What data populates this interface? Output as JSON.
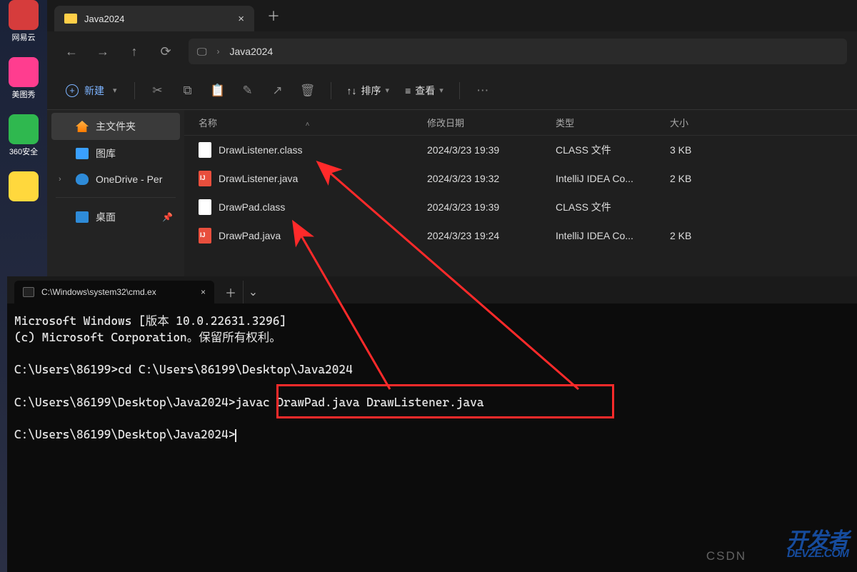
{
  "desktop": {
    "icons": [
      {
        "label": "网易云",
        "color": "#d63c3c"
      },
      {
        "label": "美图秀",
        "color": "#ff3d8f"
      },
      {
        "label": "360安全",
        "color": "#2fb84f"
      },
      {
        "label": "",
        "color": "#ffd83d"
      }
    ]
  },
  "explorer": {
    "tab_title": "Java2024",
    "breadcrumb": "Java2024",
    "new_label": "新建",
    "sort_label": "排序",
    "view_label": "查看",
    "sidebar": {
      "items": [
        {
          "label": "主文件夹",
          "icon": "home",
          "active": true
        },
        {
          "label": "图库",
          "icon": "gallery"
        },
        {
          "label": "OneDrive - Per",
          "icon": "onedrive",
          "chevron": true
        },
        {
          "label": "桌面",
          "icon": "desktop",
          "pin": true
        }
      ]
    },
    "columns": {
      "name": "名称",
      "date": "修改日期",
      "type": "类型",
      "size": "大小"
    },
    "rows": [
      {
        "name": "DrawListener.class",
        "icon": "class",
        "date": "2024/3/23 19:39",
        "type": "CLASS 文件",
        "size": "3 KB"
      },
      {
        "name": "DrawListener.java",
        "icon": "ij",
        "date": "2024/3/23 19:32",
        "type": "IntelliJ IDEA Co...",
        "size": "2 KB"
      },
      {
        "name": "DrawPad.class",
        "icon": "class",
        "date": "2024/3/23 19:39",
        "type": "CLASS 文件",
        "size": ""
      },
      {
        "name": "DrawPad.java",
        "icon": "ij",
        "date": "2024/3/23 19:24",
        "type": "IntelliJ IDEA Co...",
        "size": "2 KB"
      }
    ]
  },
  "terminal": {
    "tab_title": "C:\\Windows\\system32\\cmd.ex",
    "lines": {
      "l1": "Microsoft Windows [版本 10.0.22631.3296]",
      "l2": "(c) Microsoft Corporation。保留所有权利。",
      "l3": "",
      "l4": "C:\\Users\\86199>cd C:\\Users\\86199\\Desktop\\Java2024",
      "l5": "",
      "l6": "C:\\Users\\86199\\Desktop\\Java2024>javac DrawPad.java DrawListener.java",
      "l7": "",
      "l8": "C:\\Users\\86199\\Desktop\\Java2024>"
    }
  },
  "watermark": {
    "csdn": "CSDN",
    "logo1": "开发者",
    "logo2": "DEVZE.COM"
  }
}
